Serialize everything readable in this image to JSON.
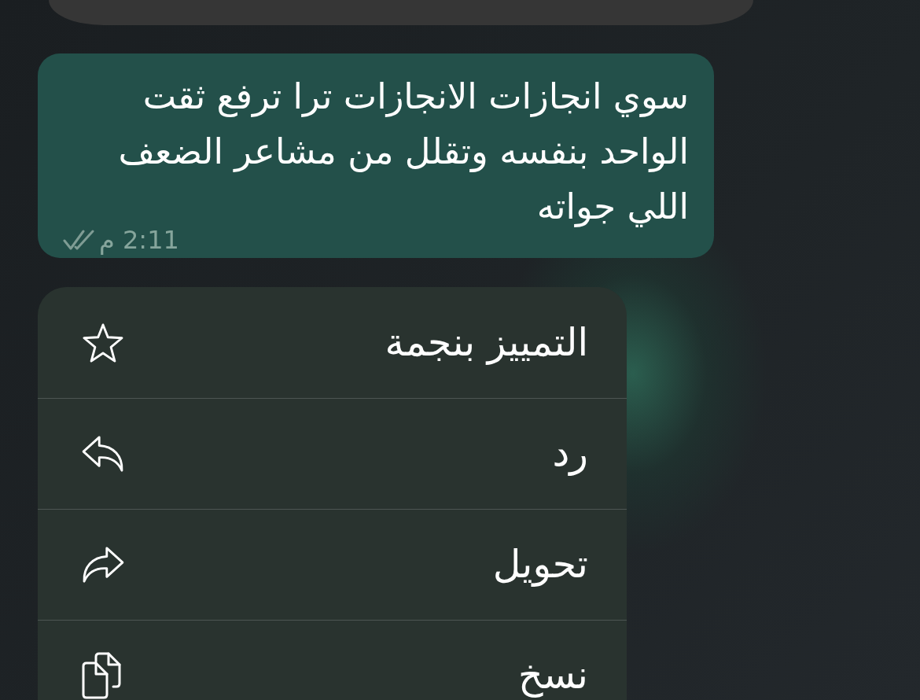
{
  "message": {
    "text": "سوي انجازات الانجازات ترا ترفع ثقت الواحد بنفسه وتقلل من مشاعر الضعف اللي جواته",
    "time": "2:11 م",
    "read": false
  },
  "menu": {
    "items": [
      {
        "label": "التمييز بنجمة"
      },
      {
        "label": "رد"
      },
      {
        "label": "تحويل"
      },
      {
        "label": "نسخ"
      }
    ]
  }
}
